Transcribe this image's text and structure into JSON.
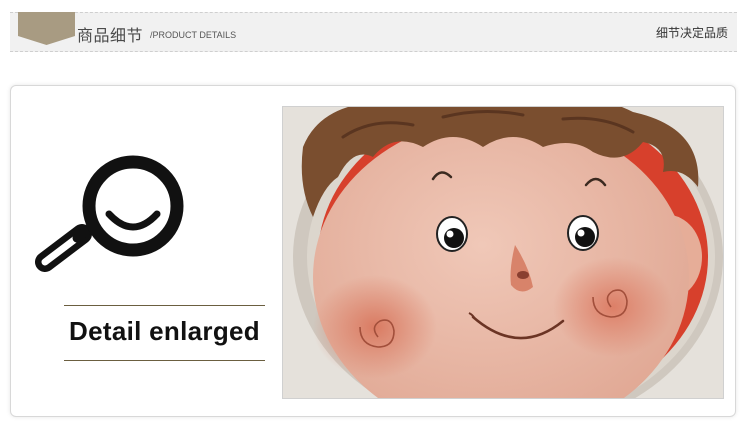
{
  "header": {
    "title": "商品细节",
    "subtitle": "/PRODUCT DETAILS",
    "right_text": "细节决定品质",
    "tag_icon": "ribbon-tag-icon"
  },
  "main": {
    "icon": "magnifier-icon",
    "label": "Detail enlarged",
    "image": "cartoon-boy-face-closeup"
  },
  "colors": {
    "header_bg": "#f1f1f1",
    "tag": "#a89b82",
    "rule": "#6b5f40",
    "skin": "#e9b7a3",
    "hair": "#7a4e2f",
    "hood": "#d7402c"
  }
}
